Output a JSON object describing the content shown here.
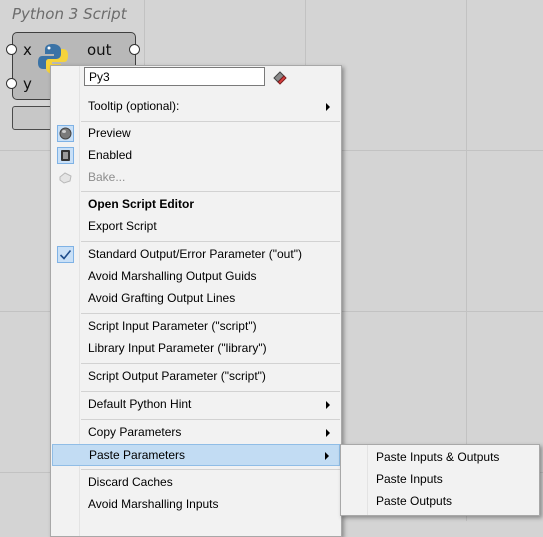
{
  "component": {
    "title": "Python 3 Script",
    "inputs": [
      "x",
      "y"
    ],
    "output": "out"
  },
  "menu": {
    "name_value": "Py3",
    "items": [
      {
        "label": "Tooltip (optional):",
        "submenu": true
      },
      {
        "label": "Preview",
        "icon": "preview-icon"
      },
      {
        "label": "Enabled",
        "icon": "enabled-icon"
      },
      {
        "label": "Bake...",
        "icon": "bake-icon",
        "disabled": true
      },
      {
        "label": "Open Script Editor",
        "bold": true
      },
      {
        "label": "Export Script"
      },
      {
        "label": "Standard Output/Error Parameter (\"out\")",
        "checked": true
      },
      {
        "label": "Avoid Marshalling Output Guids"
      },
      {
        "label": "Avoid Grafting Output Lines"
      },
      {
        "label": "Script Input Parameter (\"script\")"
      },
      {
        "label": "Library Input Parameter (\"library\")"
      },
      {
        "label": "Script Output Parameter (\"script\")"
      },
      {
        "label": "Default Python Hint",
        "submenu": true
      },
      {
        "label": "Copy Parameters",
        "submenu": true
      },
      {
        "label": "Paste Parameters",
        "submenu": true,
        "highlighted": true
      },
      {
        "label": "Discard Caches"
      },
      {
        "label": "Avoid Marshalling Inputs"
      }
    ]
  },
  "submenu": {
    "items": [
      {
        "label": "Paste Inputs & Outputs"
      },
      {
        "label": "Paste Inputs"
      },
      {
        "label": "Paste Outputs"
      }
    ]
  },
  "colors": {
    "canvas": "#d4d4d4",
    "highlight": "#c2dcf3",
    "menu_bg": "#f2f2f2"
  }
}
